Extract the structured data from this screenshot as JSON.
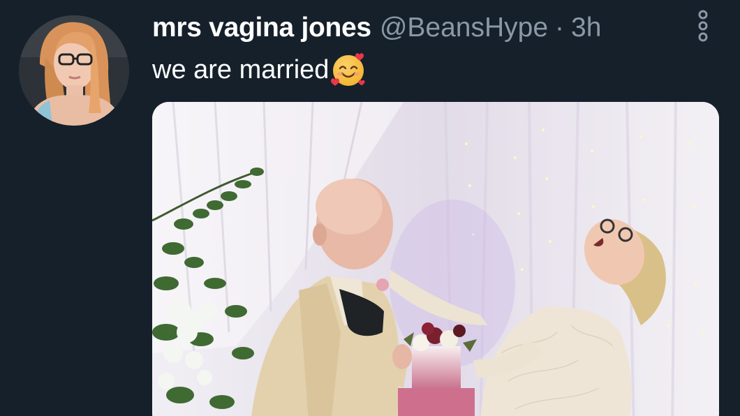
{
  "tweet": {
    "display_name": "mrs vagina jones",
    "handle": "@BeansHype",
    "separator": "·",
    "timestamp": "3h",
    "text": "we are married",
    "emoji": "smiling-face-with-hearts"
  },
  "icons": {
    "more": "vertical-ellipsis-icon"
  },
  "colors": {
    "background": "#15202b",
    "primary_text": "#ffffff",
    "secondary_text": "#8b98a5"
  }
}
